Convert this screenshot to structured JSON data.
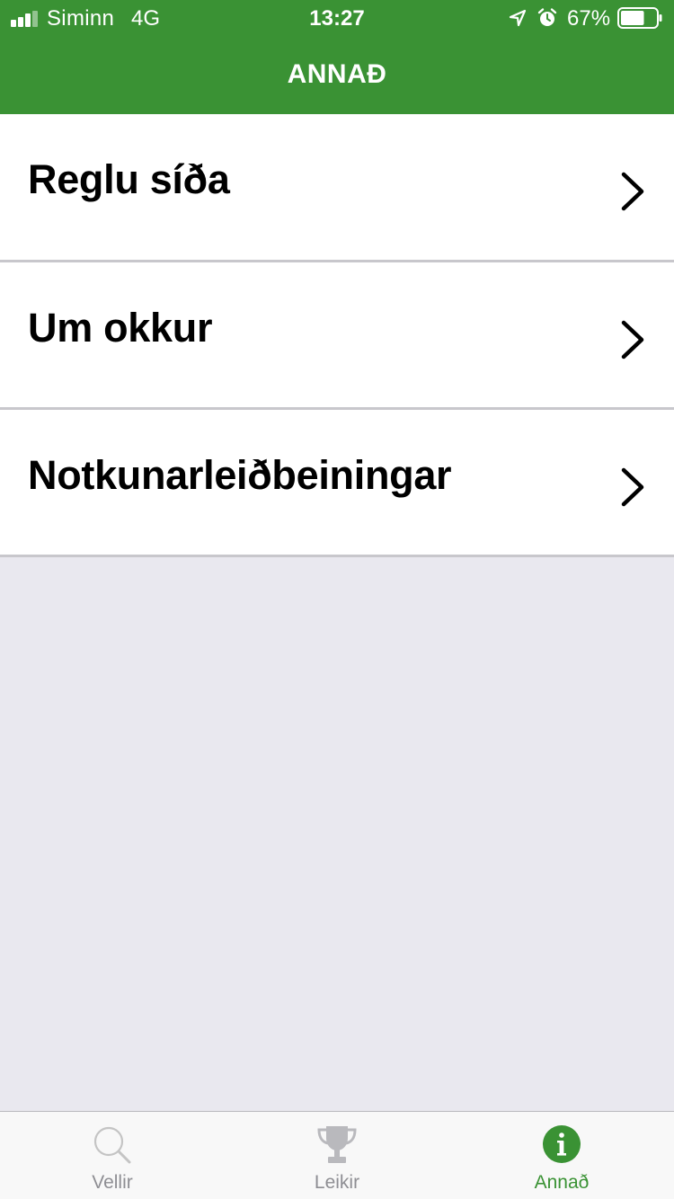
{
  "status_bar": {
    "carrier": "Siminn",
    "network": "4G",
    "time": "13:27",
    "battery": "67%",
    "battery_level": 0.67,
    "icons": [
      "signal-icon",
      "location-icon",
      "alarm-icon",
      "battery-icon"
    ]
  },
  "nav": {
    "title": "ANNAÐ"
  },
  "menu": {
    "items": [
      {
        "label": "Reglu síða",
        "icon": "chevron-right-icon"
      },
      {
        "label": "Um okkur",
        "icon": "chevron-right-icon"
      },
      {
        "label": "Notkunarleiðbeiningar",
        "icon": "chevron-right-icon"
      }
    ]
  },
  "tabbar": {
    "tabs": [
      {
        "label": "Vellir",
        "icon": "search-icon",
        "active": false
      },
      {
        "label": "Leikir",
        "icon": "trophy-icon",
        "active": false
      },
      {
        "label": "Annað",
        "icon": "info-icon",
        "active": true
      }
    ]
  },
  "colors": {
    "accent": "#3a9234",
    "background": "#e9e8ef",
    "inactive": "#8e8e93",
    "separator": "#c8c7cc"
  }
}
